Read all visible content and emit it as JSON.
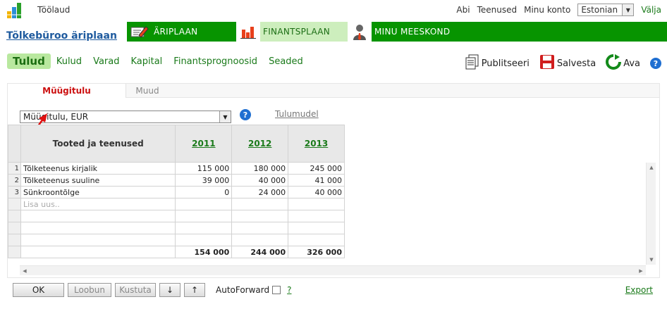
{
  "top": {
    "home": "Töölaud",
    "links": [
      "Abi",
      "Teenused",
      "Minu konto"
    ],
    "language": "Estonian",
    "exit": "Välja"
  },
  "plan_title": "Tõlkebüroo äriplaan",
  "modules": [
    {
      "label": "ÄRIPLAAN",
      "icon": "pen-document-icon"
    },
    {
      "label": "FINANTSPLAAN",
      "icon": "bar-chart-icon",
      "active": true
    },
    {
      "label": "MINU MEESKOND",
      "icon": "person-icon"
    }
  ],
  "subnav": [
    "Tulud",
    "Kulud",
    "Varad",
    "Kapital",
    "Finantsprognoosid",
    "Seaded"
  ],
  "actions": {
    "publish": "Publitseeri",
    "save": "Salvesta",
    "open": "Ava",
    "help": "?"
  },
  "panel_tabs": [
    "Müügitulu",
    "Muud"
  ],
  "view_select": "Müügitulu, EUR",
  "help_symbol": "?",
  "tulumudel": "Tulumudel",
  "table": {
    "header": "Tooted ja teenused",
    "years": [
      "2011",
      "2012",
      "2013"
    ],
    "rows": [
      {
        "n": "1",
        "name": "Tõlketeenus kirjalik",
        "v": [
          "115 000",
          "180 000",
          "245 000"
        ]
      },
      {
        "n": "2",
        "name": "Tõlketeenus suuline",
        "v": [
          "39 000",
          "40 000",
          "41 000"
        ]
      },
      {
        "n": "3",
        "name": "Sünkroontõlge",
        "v": [
          "0",
          "24 000",
          "40 000"
        ]
      }
    ],
    "placeholder": "Lisa uus..",
    "totals": [
      "154 000",
      "244 000",
      "326 000"
    ]
  },
  "buttons": {
    "ok": "OK",
    "cancel": "Loobun",
    "delete": "Kustuta",
    "down": "↓",
    "up": "↑"
  },
  "autoforward": "AutoForward",
  "autoforward_help": "?",
  "export": "Export",
  "colors": {
    "green_bar": "#079400",
    "active_tab": "#cdeebd",
    "accent_red": "#cc1111",
    "link_green": "#1a7a1a"
  }
}
